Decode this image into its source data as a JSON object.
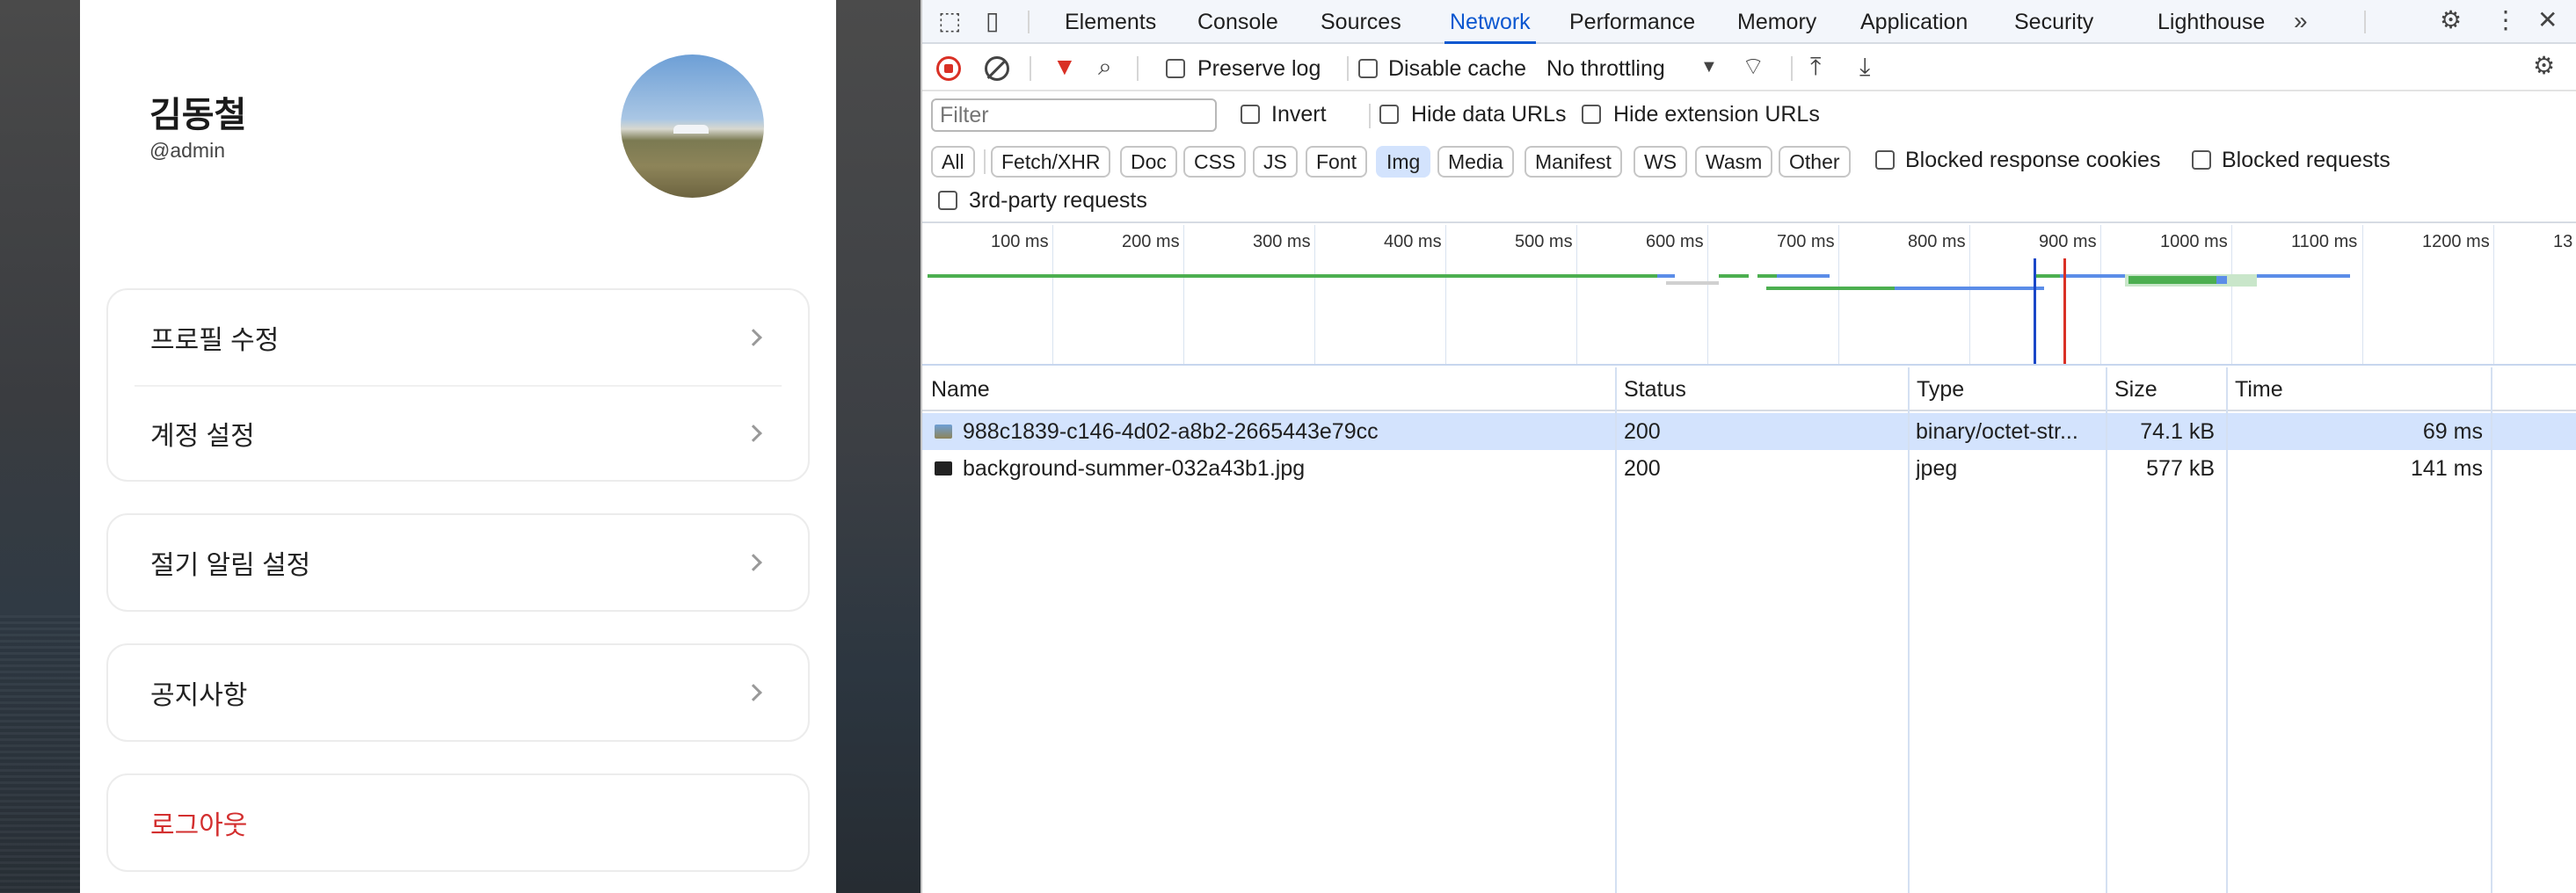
{
  "app": {
    "profile": {
      "name": "김동철",
      "handle": "@admin"
    },
    "menu_group_1": [
      {
        "label": "프로필 수정"
      },
      {
        "label": "계정 설정"
      }
    ],
    "menu_group_2": [
      {
        "label": "절기 알림 설정"
      }
    ],
    "menu_group_3": [
      {
        "label": "공지사항"
      }
    ],
    "logout": {
      "label": "로그아웃"
    }
  },
  "devtools": {
    "tabs": [
      {
        "label": "Elements"
      },
      {
        "label": "Console"
      },
      {
        "label": "Sources"
      },
      {
        "label": "Network",
        "active": true
      },
      {
        "label": "Performance"
      },
      {
        "label": "Memory"
      },
      {
        "label": "Application"
      },
      {
        "label": "Security"
      },
      {
        "label": "Lighthouse"
      }
    ],
    "toolbar": {
      "preserve_log": "Preserve log",
      "disable_cache": "Disable cache",
      "throttling": "No throttling"
    },
    "filter": {
      "placeholder": "Filter",
      "invert": "Invert",
      "hide_data_urls": "Hide data URLs",
      "hide_extension_urls": "Hide extension URLs"
    },
    "type_filters": [
      {
        "label": "All"
      },
      {
        "label": "Fetch/XHR"
      },
      {
        "label": "Doc"
      },
      {
        "label": "CSS"
      },
      {
        "label": "JS"
      },
      {
        "label": "Font"
      },
      {
        "label": "Img",
        "active": true
      },
      {
        "label": "Media"
      },
      {
        "label": "Manifest"
      },
      {
        "label": "WS"
      },
      {
        "label": "Wasm"
      },
      {
        "label": "Other"
      }
    ],
    "blocked_response_cookies": "Blocked response cookies",
    "blocked_requests": "Blocked requests",
    "third_party": "3rd-party requests",
    "timeline_ticks": [
      "100 ms",
      "200 ms",
      "300 ms",
      "400 ms",
      "500 ms",
      "600 ms",
      "700 ms",
      "800 ms",
      "900 ms",
      "1000 ms",
      "1100 ms",
      "1200 ms",
      "13"
    ],
    "table": {
      "columns": [
        "Name",
        "Status",
        "Type",
        "Size",
        "Time"
      ],
      "rows": [
        {
          "name": "988c1839-c146-4d02-a8b2-2665443e79cc",
          "status": "200",
          "type": "binary/octet-str...",
          "size": "74.1 kB",
          "time": "69 ms"
        },
        {
          "name": "background-summer-032a43b1.jpg",
          "status": "200",
          "type": "jpeg",
          "size": "577 kB",
          "time": "141 ms"
        }
      ]
    },
    "colors": {
      "accent": "#0b57d0",
      "selected_row": "#d3e3fd",
      "record_red": "#d93025",
      "filter_red": "#d93025"
    }
  }
}
